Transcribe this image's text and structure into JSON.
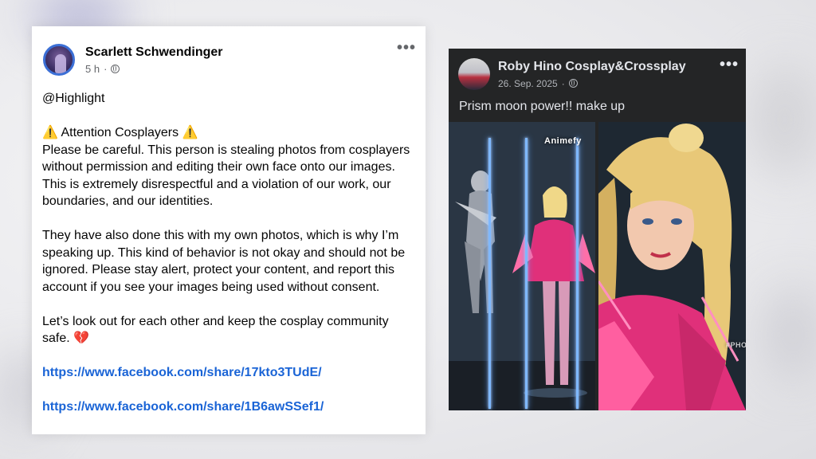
{
  "left_post": {
    "author": "Scarlett Schwendinger",
    "time": "5 h",
    "privacy_icon": "globe-icon",
    "menu_icon": "more-dots-icon",
    "tag": "@Highlight",
    "heading": "⚠️ Attention Cosplayers ⚠️",
    "para1": "Please be careful. This person is stealing photos from cosplayers without permission and editing their own face onto our images. This is extremely disrespectful and a violation of our work, our boundaries, and our identities.",
    "para2": "They have also done this with my own photos, which is why I’m speaking up. This kind of behavior is not okay and should not be ignored. Please stay alert, protect your content, and report this account if you see your images being used without consent.",
    "para3": "Let’s look out for each other and keep the cosplay community safe. 💔",
    "link1": "https://www.facebook.com/share/17kto3TUdE/",
    "link2": "https://www.facebook.com/share/1B6awSSef1/"
  },
  "right_post": {
    "author": "Roby Hino Cosplay&Crossplay",
    "date": "26. Sep. 2025",
    "privacy_icon": "globe-icon",
    "menu_icon": "more-dots-icon",
    "text": "Prism moon power!! make up",
    "watermark": "Animefy",
    "watermark_small": "#PHO"
  },
  "colors": {
    "link": "#1a64d6",
    "dark_card": "#242526",
    "light_card": "#ffffff",
    "costume_pink": "#e0307a"
  }
}
